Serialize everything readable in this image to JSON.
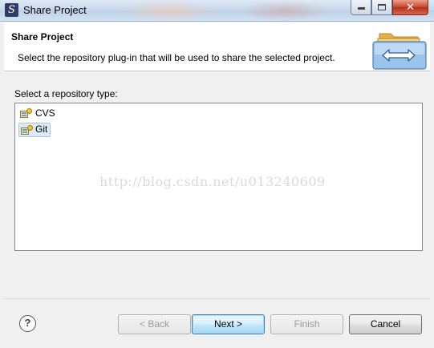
{
  "window": {
    "title": "Share Project",
    "app_icon_glyph": "S",
    "controls": {
      "minimize": "minimize-icon",
      "maximize": "maximize-icon",
      "close_glyph": "✕"
    }
  },
  "banner": {
    "title": "Share Project",
    "message": "Select the repository plug-in that will be used to share the selected project.",
    "image": "share-project-folders-icon"
  },
  "repository": {
    "prompt": "Select a repository type:",
    "items": [
      {
        "label": "CVS",
        "icon": "repository-plugin-icon",
        "selected": false
      },
      {
        "label": "Git",
        "icon": "repository-plugin-icon",
        "selected": true
      }
    ]
  },
  "watermark": "http://blog.csdn.net/u013240609",
  "footer": {
    "help_glyph": "?",
    "back_label": "< Back",
    "next_label": "Next >",
    "finish_label": "Finish",
    "cancel_label": "Cancel"
  },
  "colors": {
    "selection_bg": "#dfeaf7",
    "selection_border": "#a8c4e4",
    "close_button": "#c8442a",
    "default_button_border": "#3c7fb1"
  }
}
